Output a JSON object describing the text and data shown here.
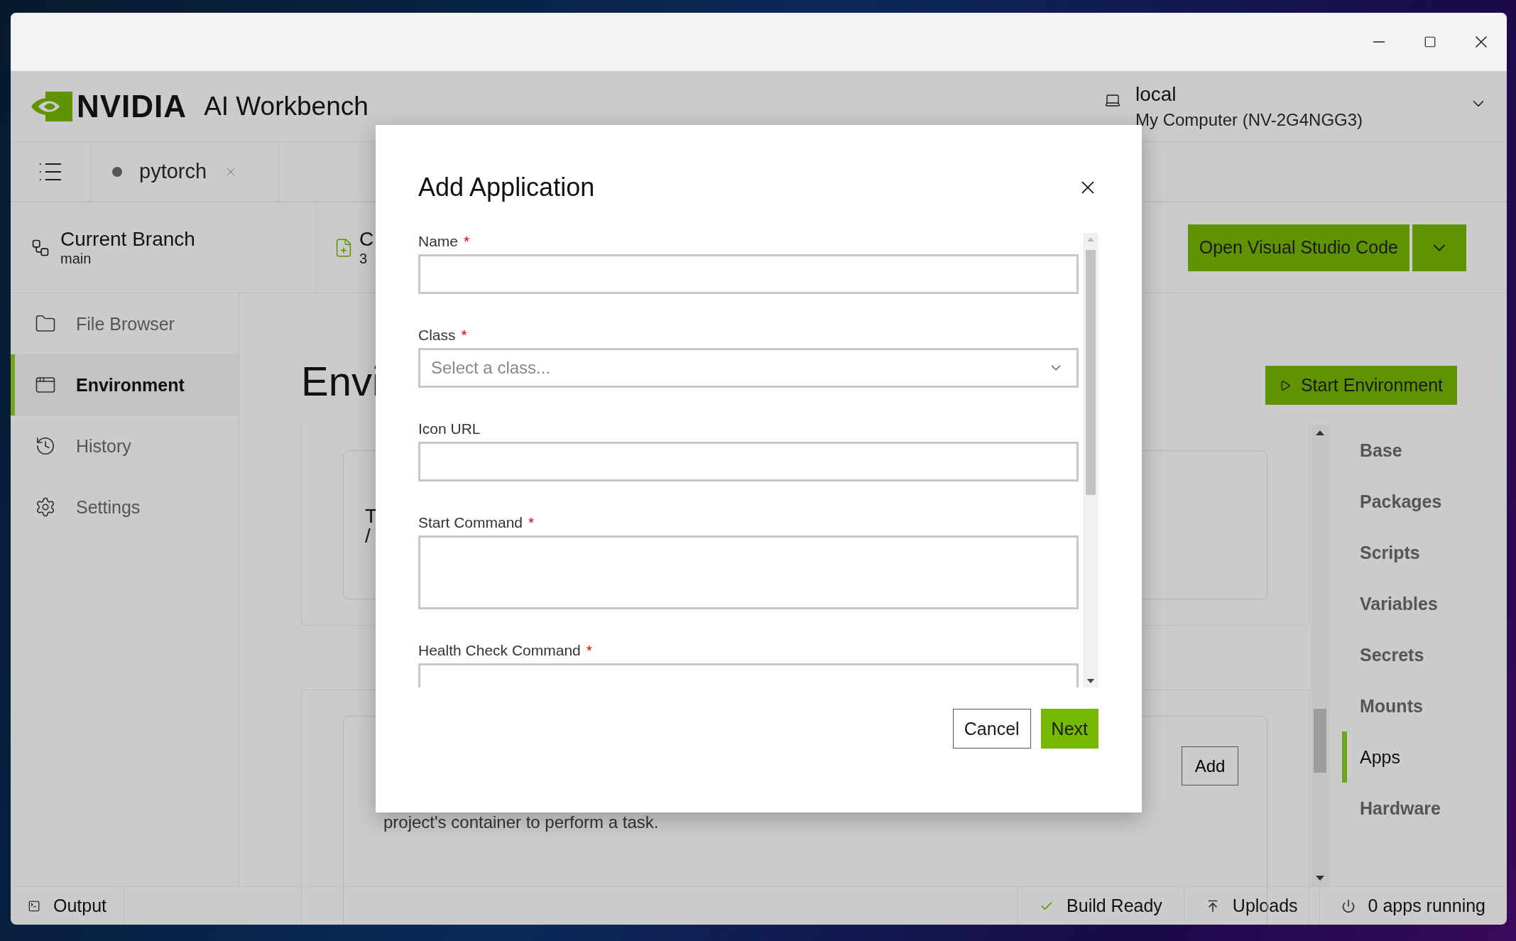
{
  "header": {
    "brand": "NVIDIA",
    "app_name": "AI Workbench",
    "location": {
      "name": "local",
      "detail": "My Computer (NV-2G4NGG3)"
    }
  },
  "tabs": [
    {
      "label": "pytorch",
      "selected": true
    }
  ],
  "branch": {
    "title": "Current Branch",
    "name": "main"
  },
  "changes": {
    "title": "C",
    "count": "3"
  },
  "toolbar": {
    "primary_button": "Open Visual Studio Code"
  },
  "sidebar": {
    "items": [
      {
        "label": "File Browser",
        "selected": false
      },
      {
        "label": "Environment",
        "selected": true
      },
      {
        "label": "History",
        "selected": false
      },
      {
        "label": "Settings",
        "selected": false
      }
    ]
  },
  "page": {
    "title": "Envi",
    "start_button": "Start Environment"
  },
  "cards": [
    {
      "lines": [
        "T",
        "/"
      ]
    },
    {
      "add_button": "Add",
      "description": "project's container to perform a task."
    }
  ],
  "section_nav": {
    "items": [
      {
        "label": "Base",
        "selected": false
      },
      {
        "label": "Packages",
        "selected": false
      },
      {
        "label": "Scripts",
        "selected": false
      },
      {
        "label": "Variables",
        "selected": false
      },
      {
        "label": "Secrets",
        "selected": false
      },
      {
        "label": "Mounts",
        "selected": false
      },
      {
        "label": "Apps",
        "selected": true
      },
      {
        "label": "Hardware",
        "selected": false
      }
    ]
  },
  "status_bar": {
    "output": "Output",
    "items": [
      {
        "kind": "build",
        "label": "Build Ready"
      },
      {
        "kind": "uploads",
        "label": "Uploads"
      },
      {
        "kind": "apps",
        "label": "0 apps running"
      }
    ]
  },
  "dialog": {
    "title": "Add Application",
    "fields": [
      {
        "label": "Name",
        "required_mark": "*",
        "kind": "text"
      },
      {
        "label": "Class",
        "required_mark": "*",
        "kind": "select",
        "placeholder": "Select a class..."
      },
      {
        "label": "Icon URL",
        "kind": "text"
      },
      {
        "label": "Start Command",
        "required_mark": "*",
        "kind": "textarea"
      },
      {
        "label": "Health Check Command",
        "required_mark": "*",
        "kind": "textarea"
      }
    ],
    "buttons": [
      {
        "label": "Cancel",
        "kind": "secondary"
      },
      {
        "label": "Next",
        "kind": "primary"
      }
    ]
  }
}
